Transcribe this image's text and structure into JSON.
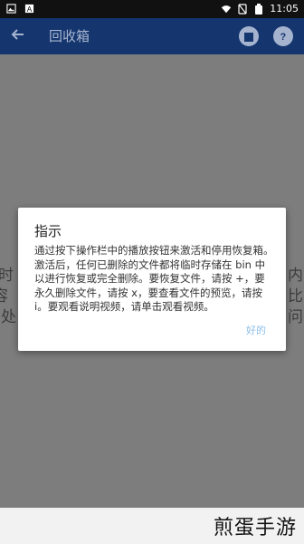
{
  "status": {
    "time": "11:05",
    "left_icons": [
      "gallery-icon",
      "text-icon"
    ],
    "right_icons": [
      "wifi-icon",
      "no-sim-icon",
      "battery-icon"
    ]
  },
  "appbar": {
    "title": "回收箱",
    "back_icon": "arrow-left-icon",
    "actions": [
      "stop-icon",
      "help-icon"
    ]
  },
  "background": {
    "left_chars": [
      "时",
      "容",
      "处"
    ],
    "right_chars": [
      "内",
      "比",
      "问"
    ]
  },
  "dialog": {
    "title": "指示",
    "message": "通过按下操作栏中的播放按钮来激活和停用恢复箱。激活后，任何已删除的文件都将临时存储在 bin 中以进行恢复或完全删除。要恢复文件，请按 +，要永久删除文件，请按 x，要查看文件的预览，请按 i。要观看说明视频，请单击观看视频。",
    "ok_label": "好的"
  },
  "watermark": "煎蛋手游"
}
